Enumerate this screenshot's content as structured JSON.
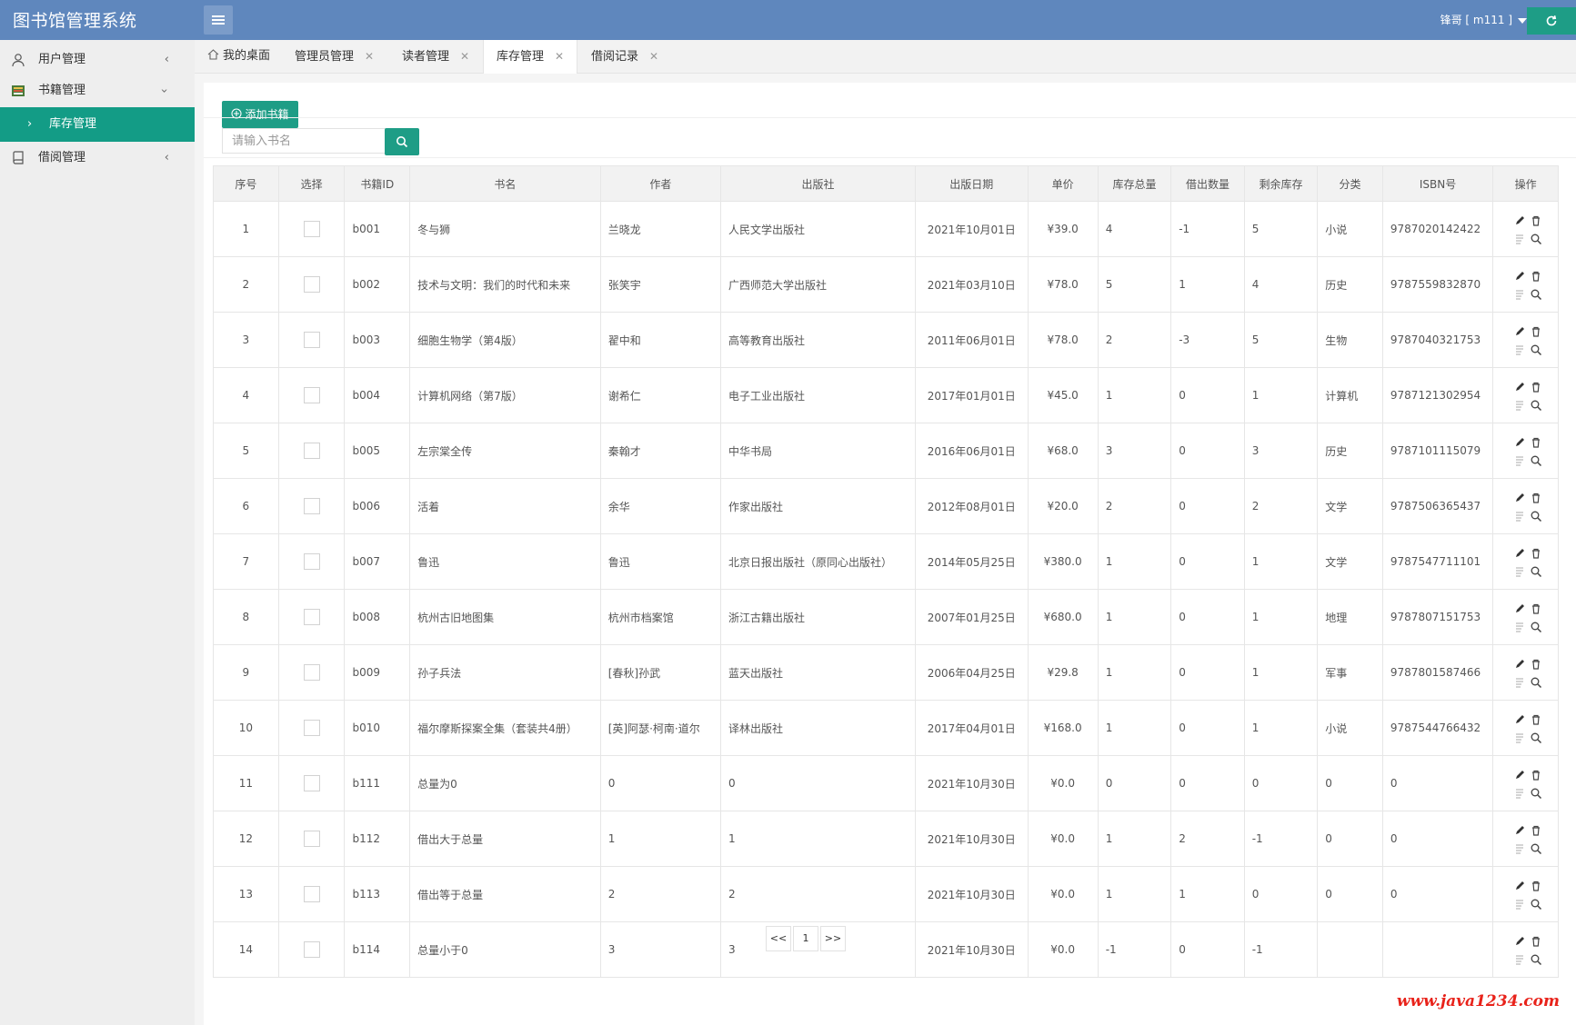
{
  "app": {
    "title": "图书馆管理系统"
  },
  "header": {
    "user": "锋哥 [ m111 ]"
  },
  "sidebar": {
    "items": [
      {
        "label": "用户管理",
        "icon": "user-icon"
      },
      {
        "label": "书籍管理",
        "icon": "books-icon",
        "expanded": true,
        "children": [
          {
            "label": "库存管理",
            "active": true
          }
        ]
      },
      {
        "label": "借阅管理",
        "icon": "book-icon"
      }
    ]
  },
  "tabs": [
    {
      "label": "我的桌面",
      "home": true
    },
    {
      "label": "管理员管理",
      "closable": true
    },
    {
      "label": "读者管理",
      "closable": true
    },
    {
      "label": "库存管理",
      "closable": true,
      "active": true
    },
    {
      "label": "借阅记录",
      "closable": true
    }
  ],
  "toolbar": {
    "add_label": "添加书籍",
    "search_placeholder": "请输入书名"
  },
  "table": {
    "headers": [
      "序号",
      "选择",
      "书籍ID",
      "书名",
      "作者",
      "出版社",
      "出版日期",
      "单价",
      "库存总量",
      "借出数量",
      "剩余库存",
      "分类",
      "ISBN号",
      "操作"
    ],
    "rows": [
      [
        "1",
        "b001",
        "冬与狮",
        "兰晓龙",
        "人民文学出版社",
        "2021年10月01日",
        "¥39.0",
        "4",
        "-1",
        "5",
        "小说",
        "9787020142422"
      ],
      [
        "2",
        "b002",
        "技术与文明：我们的时代和未来",
        "张笑宇",
        "广西师范大学出版社",
        "2021年03月10日",
        "¥78.0",
        "5",
        "1",
        "4",
        "历史",
        "9787559832870"
      ],
      [
        "3",
        "b003",
        "细胞生物学（第4版）",
        "翟中和",
        "高等教育出版社",
        "2011年06月01日",
        "¥78.0",
        "2",
        "-3",
        "5",
        "生物",
        "9787040321753"
      ],
      [
        "4",
        "b004",
        "计算机网络（第7版）",
        "谢希仁",
        "电子工业出版社",
        "2017年01月01日",
        "¥45.0",
        "1",
        "0",
        "1",
        "计算机",
        "9787121302954"
      ],
      [
        "5",
        "b005",
        "左宗棠全传",
        "秦翰才",
        "中华书局",
        "2016年06月01日",
        "¥68.0",
        "3",
        "0",
        "3",
        "历史",
        "9787101115079"
      ],
      [
        "6",
        "b006",
        "活着",
        "余华",
        "作家出版社",
        "2012年08月01日",
        "¥20.0",
        "2",
        "0",
        "2",
        "文学",
        "9787506365437"
      ],
      [
        "7",
        "b007",
        "鲁迅",
        "鲁迅",
        "北京日报出版社（原同心出版社）",
        "2014年05月25日",
        "¥380.0",
        "1",
        "0",
        "1",
        "文学",
        "9787547711101"
      ],
      [
        "8",
        "b008",
        "杭州古旧地图集",
        "杭州市档案馆",
        "浙江古籍出版社",
        "2007年01月25日",
        "¥680.0",
        "1",
        "0",
        "1",
        "地理",
        "9787807151753"
      ],
      [
        "9",
        "b009",
        "孙子兵法",
        "[春秋]孙武",
        "蓝天出版社",
        "2006年04月25日",
        "¥29.8",
        "1",
        "0",
        "1",
        "军事",
        "9787801587466"
      ],
      [
        "10",
        "b010",
        "福尔摩斯探案全集（套装共4册）",
        "[英]阿瑟·柯南·道尔",
        "译林出版社",
        "2017年04月01日",
        "¥168.0",
        "1",
        "0",
        "1",
        "小说",
        "9787544766432"
      ],
      [
        "11",
        "b111",
        "总量为0",
        "0",
        "0",
        "2021年10月30日",
        "¥0.0",
        "0",
        "0",
        "0",
        "0",
        "0"
      ],
      [
        "12",
        "b112",
        "借出大于总量",
        "1",
        "1",
        "2021年10月30日",
        "¥0.0",
        "1",
        "2",
        "-1",
        "0",
        "0"
      ],
      [
        "13",
        "b113",
        "借出等于总量",
        "2",
        "2",
        "2021年10月30日",
        "¥0.0",
        "1",
        "1",
        "0",
        "0",
        "0"
      ],
      [
        "14",
        "b114",
        "总量小于0",
        "3",
        "3",
        "2021年10月30日",
        "¥0.0",
        "-1",
        "0",
        "-1",
        "",
        ""
      ]
    ]
  },
  "pager": {
    "prev": "<<",
    "current": "1",
    "next": ">>"
  },
  "watermark": "www.java1234.com",
  "colors": {
    "header": "#5f87bd",
    "accent": "#1e9d86",
    "watermark": "#e8221a"
  }
}
